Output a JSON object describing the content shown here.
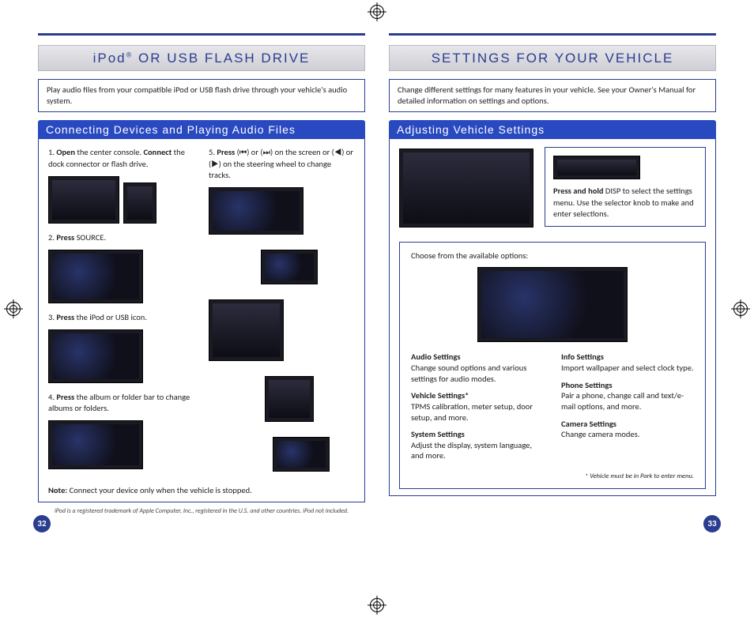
{
  "left": {
    "title_pre": "iPod",
    "title_sup": "®",
    "title_post": " OR USB FLASH DRIVE",
    "intro": "Play audio files from your compatible iPod or USB flash drive through your vehicle's audio system.",
    "section_header": "Connecting Devices and Playing Audio Files",
    "steps": {
      "s1_a": "Open",
      "s1_b": " the center console. ",
      "s1_c": "Connect",
      "s1_d": " the dock connector or flash drive.",
      "s2_a": "Press",
      "s2_b": " SOURCE.",
      "s3_a": "Press",
      "s3_b": " the iPod or USB icon.",
      "s4_a": "Press",
      "s4_b": " the album or folder bar to change albums or folders.",
      "s5_a": "Press",
      "s5_b": " (",
      "s5_c": ") or (",
      "s5_d": ") on the screen or (",
      "s5_e": ") or (",
      "s5_f": ") on the steering wheel to change tracks."
    },
    "note_label": "Note:",
    "note_text": " Connect your device only when the vehicle is stopped.",
    "trademark": "iPod is a registered trademark of Apple Computer, Inc., registered in the U.S. and other countries. iPod not included.",
    "page_num": "32"
  },
  "right": {
    "title": "SETTINGS FOR YOUR VEHICLE",
    "intro": "Change different settings for many features in your vehicle. See your Owner's Manual for detailed information on settings and options.",
    "section_header": "Adjusting Vehicle Settings",
    "tip_a": "Press and hold",
    "tip_b": " DISP to select the settings menu. Use the selector knob to make and enter selections.",
    "options_intro": "Choose from the available options:",
    "opts": {
      "audio_t": "Audio Settings",
      "audio_d": "Change sound options and various settings for audio modes.",
      "vehicle_t": "Vehicle Settings*",
      "vehicle_d": "TPMS calibration, meter setup, door setup, and more.",
      "system_t": "System Settings",
      "system_d": "Adjust the display, system language, and more.",
      "info_t": "Info Settings",
      "info_d": "Import wallpaper and select clock type.",
      "phone_t": "Phone Settings",
      "phone_d": "Pair a phone, change call and text/e-mail options, and more.",
      "camera_t": "Camera Settings",
      "camera_d": "Change camera modes."
    },
    "foot_note": "* Vehicle must be in Park to enter menu.",
    "page_num": "33"
  }
}
